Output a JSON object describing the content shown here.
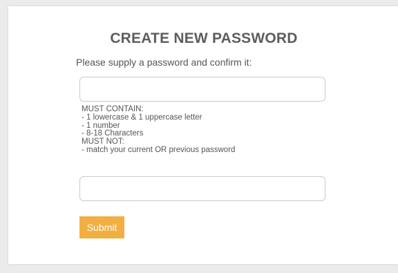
{
  "form": {
    "title": "CREATE NEW PASSWORD",
    "prompt": "Please supply a password and confirm it:",
    "password_input": {
      "value": "",
      "placeholder": ""
    },
    "rules": [
      "MUST CONTAIN:",
      "- 1 lowercase & 1 uppercase letter",
      "- 1 number",
      "- 8-18 Characters",
      "MUST NOT:",
      "- match your current OR previous password"
    ],
    "confirm_input": {
      "value": "",
      "placeholder": ""
    },
    "submit_label": "Submit"
  },
  "colors": {
    "page_background": "#ebebeb",
    "card_background": "#ffffff",
    "submit_button": "#f3ae42",
    "text": "#555555",
    "title": "#5d5d5d"
  }
}
